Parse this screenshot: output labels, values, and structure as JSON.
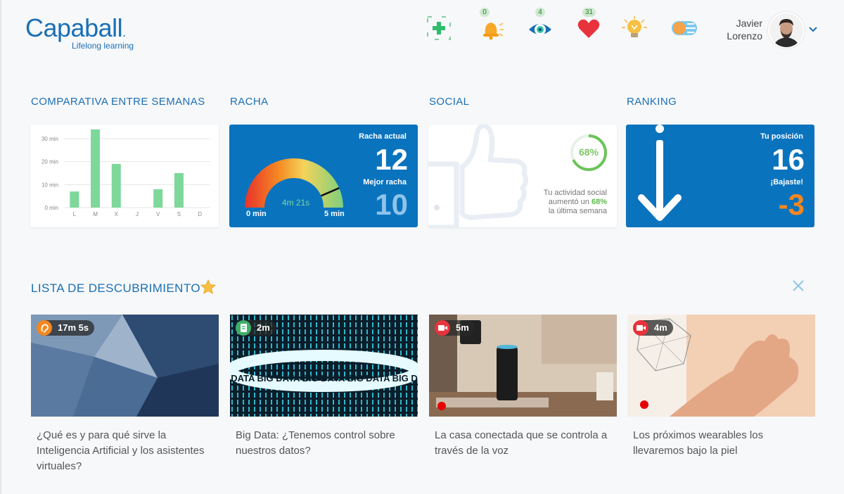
{
  "header": {
    "logo_text": "Capaball",
    "logo_tagline": "Lifelong learning",
    "badges": {
      "alerts": "0",
      "views": "4",
      "likes": "31"
    },
    "user": {
      "first_name": "Javier",
      "last_name": "Lorenzo"
    }
  },
  "sections": {
    "weekly": "COMPARATIVA ENTRE SEMANAS",
    "streak": "RACHA",
    "social": "SOCIAL",
    "ranking": "RANKING",
    "discovery": "LISTA DE DESCUBRIMIENTO"
  },
  "chart_data": {
    "type": "bar",
    "categories": [
      "L",
      "M",
      "X",
      "J",
      "V",
      "S",
      "D"
    ],
    "values": [
      7,
      34,
      19,
      0,
      8,
      15,
      0
    ],
    "ylim": [
      0,
      30
    ],
    "yticks": [
      "0 min",
      "10 min",
      "20 min",
      "30 min"
    ],
    "ytick_values": [
      0,
      10,
      20,
      30
    ],
    "grid": true,
    "bar_color": "#7dd89a"
  },
  "streak": {
    "current_label": "Racha actual",
    "current_value": "12",
    "best_label": "Mejor racha",
    "best_value": "10",
    "gauge_value_text": "4m 21s",
    "gauge_min": "0 min",
    "gauge_max": "5 min",
    "gauge_fraction": 0.87
  },
  "social": {
    "percent_text": "68%",
    "percent": 68,
    "line1": "Tu actividad social",
    "line2_prefix": "aumentó un",
    "line2_pct": "68%",
    "line3": "la última semana"
  },
  "ranking": {
    "position_label": "Tu posición",
    "position_value": "16",
    "change_label": "¡Bajaste!",
    "change_value": "-3"
  },
  "discovery": {
    "items": [
      {
        "duration": "17m 5s",
        "type": "audio",
        "title": "¿Qué es y para qué sirve la Inteligencia Artificial y los asistentes virtuales?"
      },
      {
        "duration": "2m",
        "type": "document",
        "title": "Big Data: ¿Tenemos control sobre nuestros datos?"
      },
      {
        "duration": "5m",
        "type": "video",
        "title": "La casa conectada que se controla a través de la voz"
      },
      {
        "duration": "4m",
        "type": "video",
        "title": "Los próximos wearables los llevaremos bajo la piel"
      }
    ],
    "big_data_text": "BIG DATA BIG DATA BIG DATA BIG DATA BIG DATA"
  },
  "colors": {
    "brand_blue": "#1a6fb5",
    "card_blue": "#0a73be",
    "green": "#5cba4a",
    "orange": "#f5871f"
  }
}
